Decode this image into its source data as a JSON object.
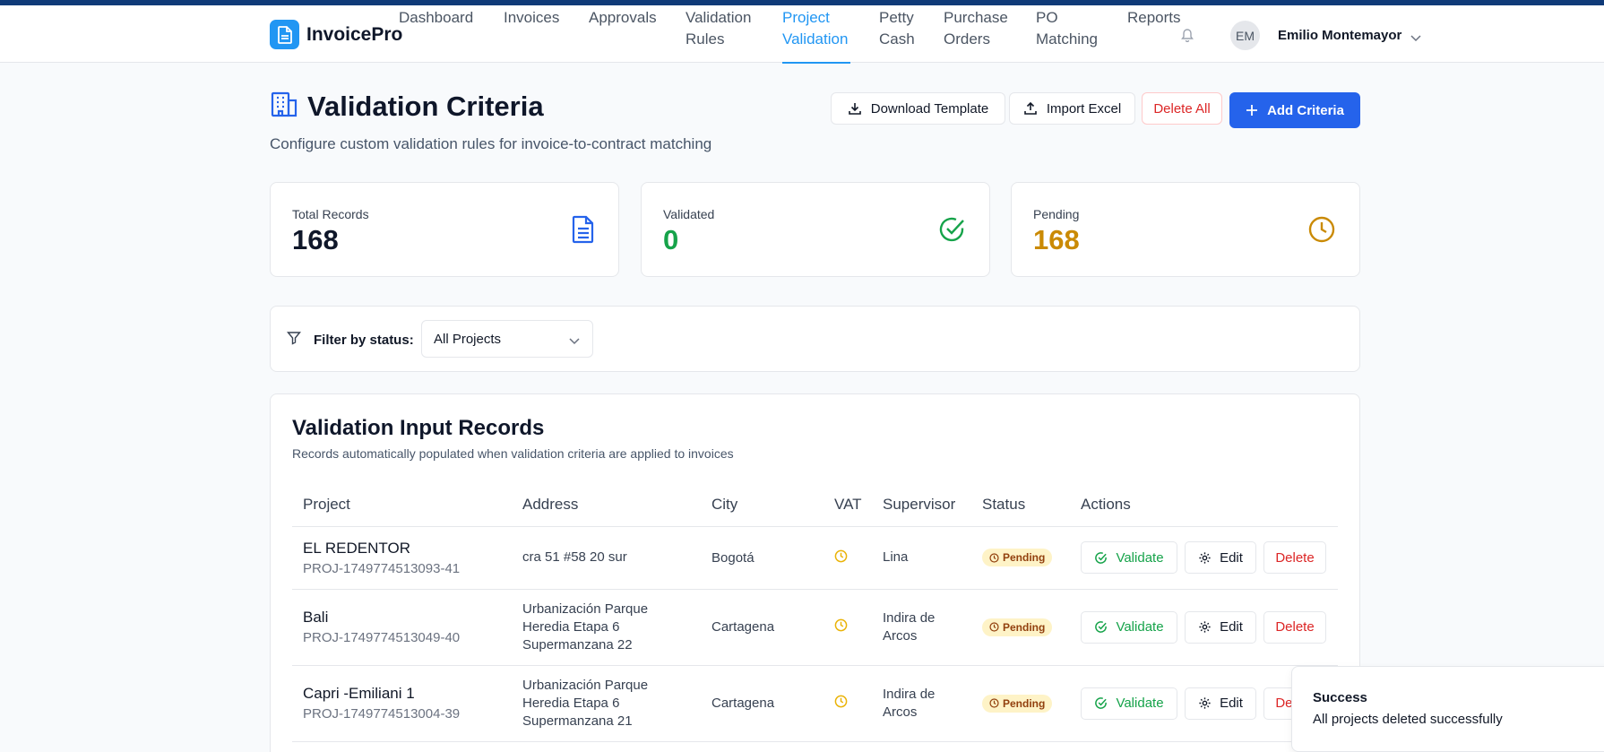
{
  "app": {
    "name": "InvoicePro",
    "logo_icon": "document-icon"
  },
  "nav": {
    "items": [
      {
        "label": "Dashboard",
        "active": false
      },
      {
        "label": "Invoices",
        "active": false
      },
      {
        "label": "Approvals",
        "active": false
      },
      {
        "label": "Validation Rules",
        "active": false
      },
      {
        "label": "Project Validation",
        "active": true
      },
      {
        "label": "Petty Cash",
        "active": false
      },
      {
        "label": "Purchase Orders",
        "active": false
      },
      {
        "label": "PO Matching",
        "active": false
      },
      {
        "label": "Reports",
        "active": false
      }
    ]
  },
  "user": {
    "initials": "EM",
    "name": "Emilio Montemayor"
  },
  "page": {
    "title": "Validation Criteria",
    "subtitle": "Configure custom validation rules for invoice-to-contract matching"
  },
  "toolbar": {
    "download_label": "Download Template",
    "import_label": "Import Excel",
    "delete_all_label": "Delete All",
    "add_label": "Add Criteria"
  },
  "stats": [
    {
      "label": "Total Records",
      "value": "168",
      "color": "#0f172a",
      "icon": "document-icon"
    },
    {
      "label": "Validated",
      "value": "0",
      "color": "#16a34a",
      "icon": "check-circle-icon"
    },
    {
      "label": "Pending",
      "value": "168",
      "color": "#ca8a04",
      "icon": "clock-icon"
    }
  ],
  "filter": {
    "label": "Filter by status:",
    "selected": "All Projects"
  },
  "records": {
    "title": "Validation Input Records",
    "subtitle": "Records automatically populated when validation criteria are applied to invoices",
    "columns": [
      "Project",
      "Address",
      "City",
      "VAT",
      "Supervisor",
      "Status",
      "Actions"
    ],
    "rows": [
      {
        "name": "EL REDENTOR",
        "id": "PROJ-1749774513093-41",
        "address": [
          "cra 51 #58 20 sur"
        ],
        "city": "Bogotá",
        "supervisor": [
          "Lina"
        ],
        "status": "Pending"
      },
      {
        "name": "Bali",
        "id": "PROJ-1749774513049-40",
        "address": [
          "Urbanización Parque",
          "Heredia Etapa 6",
          "Supermanzana 22"
        ],
        "city": "Cartagena",
        "supervisor": [
          "Indira de",
          "Arcos"
        ],
        "status": "Pending"
      },
      {
        "name": "Capri -Emiliani 1",
        "id": "PROJ-1749774513004-39",
        "address": [
          "Urbanización Parque",
          "Heredia Etapa 6",
          "Supermanzana 21"
        ],
        "city": "Cartagena",
        "supervisor": [
          "Indira de",
          "Arcos"
        ],
        "status": "Pending"
      }
    ],
    "action_labels": {
      "validate": "Validate",
      "edit": "Edit",
      "delete": "Delete"
    }
  },
  "toast": {
    "title": "Success",
    "message": "All projects deleted successfully"
  },
  "colors": {
    "primary": "#2563eb",
    "active_nav": "#2196f3",
    "success": "#16a34a",
    "warning": "#ca8a04",
    "danger": "#dc2626"
  }
}
